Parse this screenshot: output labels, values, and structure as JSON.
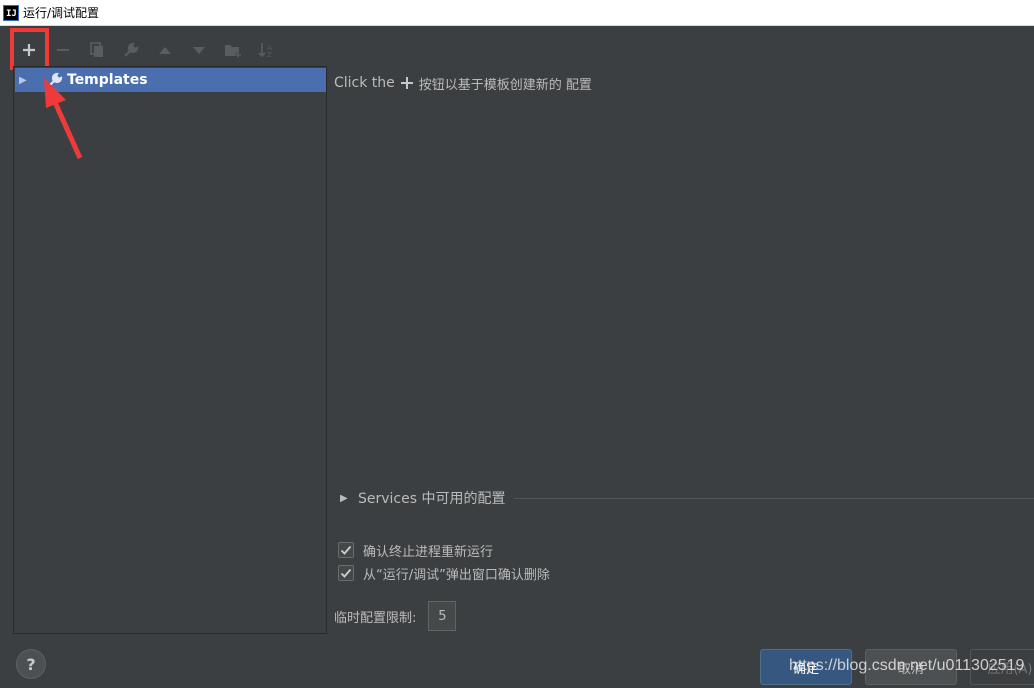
{
  "window": {
    "title": "运行/调试配置",
    "app_icon_text": "IJ"
  },
  "toolbar": {
    "buttons": [
      {
        "name": "add",
        "icon": "plus-icon"
      },
      {
        "name": "remove",
        "icon": "minus-icon"
      },
      {
        "name": "copy",
        "icon": "copy-icon"
      },
      {
        "name": "edit-defaults",
        "icon": "wrench-icon"
      },
      {
        "name": "move-up",
        "icon": "arrow-up-icon"
      },
      {
        "name": "move-down",
        "icon": "arrow-down-icon"
      },
      {
        "name": "new-folder",
        "icon": "folder-add-icon"
      },
      {
        "name": "sort",
        "icon": "sort-az-icon"
      }
    ]
  },
  "tree": {
    "items": [
      {
        "label": "Templates",
        "icon": "wrench-icon",
        "selected": true
      }
    ]
  },
  "hint": {
    "prefix": "Click the",
    "suffix": "按钮以基于模板创建新的 配置"
  },
  "services": {
    "label": "Services 中可用的配置"
  },
  "options": {
    "confirm_rerun": {
      "label": "确认终止进程重新运行",
      "checked": true
    },
    "confirm_delete": {
      "label": "从“运行/调试”弹出窗口确认删除",
      "checked": true
    }
  },
  "temp_limit": {
    "label": "临时配置限制:",
    "value": "5"
  },
  "buttons": {
    "help": "?",
    "ok": "确定",
    "cancel": "取消",
    "apply": "应用(A)"
  },
  "watermark": "https://blog.csdn.net/u011302519",
  "colors": {
    "background": "#3c3f41",
    "selection": "#4b6eaf",
    "highlight": "#f03a3a",
    "primary_button": "#365880"
  }
}
